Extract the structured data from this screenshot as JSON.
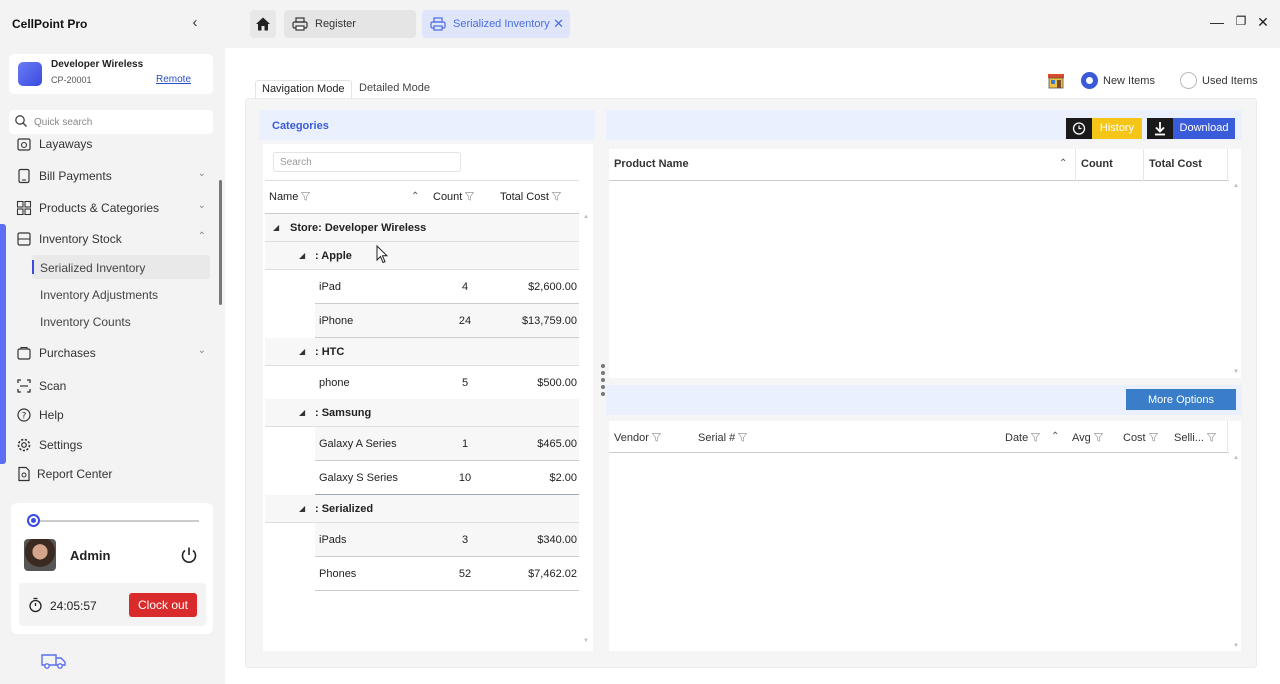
{
  "app": {
    "title": "CellPoint Pro"
  },
  "store": {
    "name": "Developer Wireless",
    "code": "CP-20001",
    "remote_label": "Remote"
  },
  "sidebar": {
    "search_placeholder": "Quick search",
    "items": [
      {
        "label": "Layaways",
        "icon": "layaway-icon"
      },
      {
        "label": "Bill Payments",
        "icon": "bill-icon"
      },
      {
        "label": "Products & Categories",
        "icon": "products-icon"
      },
      {
        "label": "Inventory Stock",
        "icon": "inventory-icon"
      },
      {
        "label": "Purchases",
        "icon": "purchases-icon"
      },
      {
        "label": "Scan",
        "icon": "scan-icon"
      },
      {
        "label": "Help",
        "icon": "help-icon"
      },
      {
        "label": "Settings",
        "icon": "gear-icon"
      },
      {
        "label": "Report Center",
        "icon": "report-icon"
      }
    ],
    "subitems": [
      {
        "label": "Serialized Inventory",
        "active": true
      },
      {
        "label": "Inventory Adjustments"
      },
      {
        "label": "Inventory Counts"
      }
    ]
  },
  "user": {
    "name": "Admin",
    "timer": "24:05:57",
    "clockout_label": "Clock out"
  },
  "tabs": [
    {
      "label": "Register",
      "icon": "printer-icon"
    },
    {
      "label": "Serialized Inventory",
      "icon": "printer-icon",
      "active": true
    }
  ],
  "modes": {
    "navigation": "Navigation Mode",
    "detailed": "Detailed Mode"
  },
  "item_filter": {
    "new_label": "New Items",
    "used_label": "Used Items",
    "selected": "new"
  },
  "categories": {
    "title": "Categories",
    "search_placeholder": "Search",
    "columns": {
      "name": "Name",
      "count": "Count",
      "total_cost": "Total Cost"
    },
    "store_row": "Store: Developer Wireless",
    "groups": [
      {
        "label": ": Apple",
        "items": [
          {
            "name": "iPad",
            "count": "4",
            "cost": "$2,600.00"
          },
          {
            "name": "iPhone",
            "count": "24",
            "cost": "$13,759.00"
          }
        ]
      },
      {
        "label": ": HTC",
        "items": [
          {
            "name": "phone",
            "count": "5",
            "cost": "$500.00"
          }
        ]
      },
      {
        "label": ": Samsung",
        "items": [
          {
            "name": "Galaxy A Series",
            "count": "1",
            "cost": "$465.00"
          },
          {
            "name": "Galaxy S Series",
            "count": "10",
            "cost": "$2.00"
          }
        ]
      },
      {
        "label": ": Serialized",
        "items": [
          {
            "name": "iPads",
            "count": "3",
            "cost": "$340.00"
          },
          {
            "name": "Phones",
            "count": "52",
            "cost": "$7,462.02"
          }
        ]
      }
    ]
  },
  "actions": {
    "history_label": "History",
    "download_label": "Download",
    "more_options_label": "More Options"
  },
  "product_grid": {
    "columns": {
      "product_name": "Product Name",
      "count": "Count",
      "total_cost": "Total Cost"
    }
  },
  "serial_grid": {
    "columns": {
      "vendor": "Vendor",
      "serial": "Serial #",
      "date": "Date",
      "avg": "Avg",
      "cost": "Cost",
      "selling": "Selli..."
    }
  },
  "colors": {
    "accent": "#3a5bd9",
    "clockout": "#d92b2b",
    "history": "#f5c518"
  }
}
